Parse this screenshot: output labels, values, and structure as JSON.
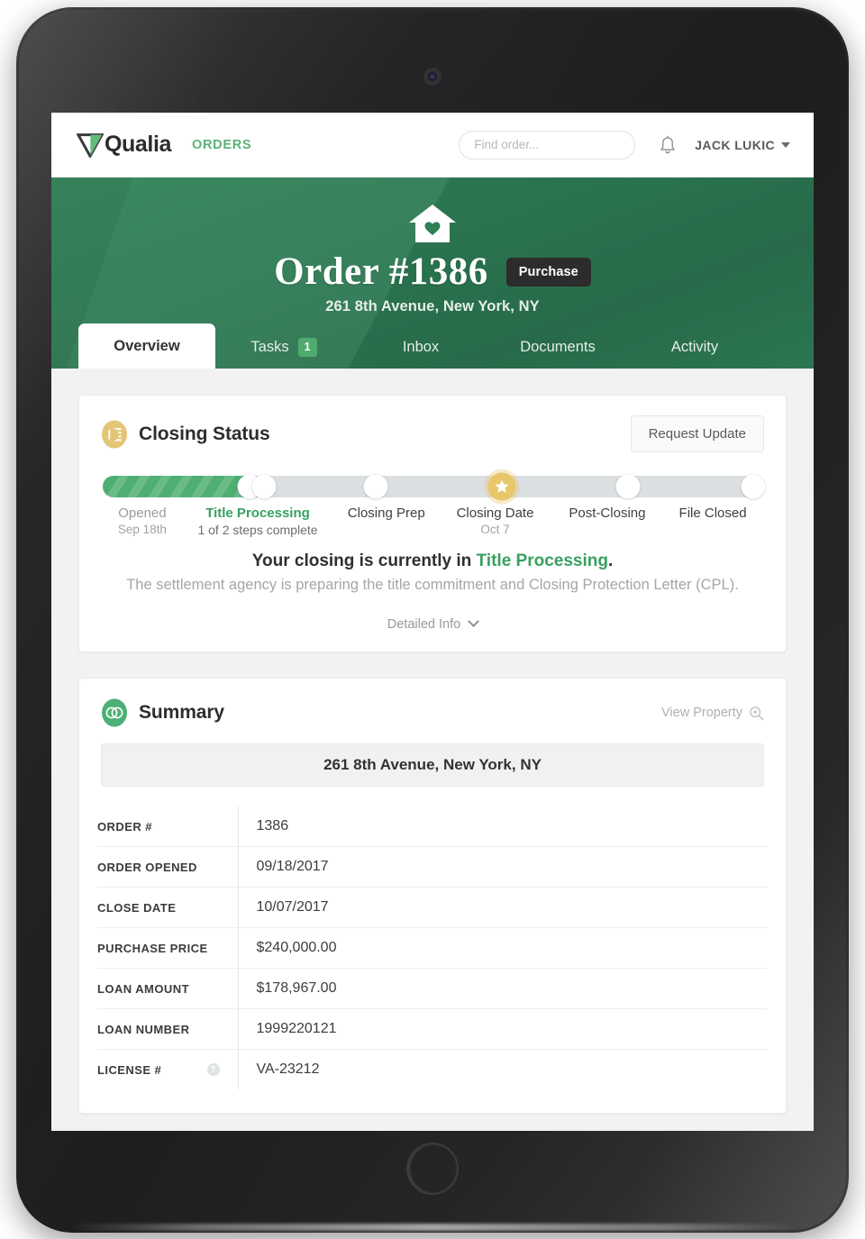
{
  "nav": {
    "logo_text": "Qualia",
    "logo_icon": "qualia-v-logo",
    "orders_link": "ORDERS",
    "search_placeholder": "Find order...",
    "search_value": "",
    "search_icon": "search-icon",
    "bell_icon": "bell-icon",
    "user_name": "JACK LUKIC",
    "caret_icon": "chevron-down-icon"
  },
  "hero": {
    "house_icon": "house-heart-icon",
    "title": "Order #1386",
    "badge": "Purchase",
    "address": "261 8th Avenue, New York, NY"
  },
  "tabs": [
    {
      "label": "Overview",
      "badge": null,
      "active": true
    },
    {
      "label": "Tasks",
      "badge": "1",
      "active": false
    },
    {
      "label": "Inbox",
      "badge": null,
      "active": false
    },
    {
      "label": "Documents",
      "badge": null,
      "active": false
    },
    {
      "label": "Activity",
      "badge": null,
      "active": false
    }
  ],
  "closing_status": {
    "icon": "document-lines-icon",
    "title": "Closing Status",
    "request_update_label": "Request Update",
    "progress_percent": 24.5,
    "steps": [
      {
        "name": "Opened",
        "sub": "Sep 18th",
        "state": "done",
        "node": "plain"
      },
      {
        "name": "Title Processing",
        "sub": "1 of 2 steps complete",
        "state": "current",
        "node": "plain"
      },
      {
        "name": "Closing Prep",
        "sub": "",
        "state": "pending",
        "node": "plain"
      },
      {
        "name": "Closing Date",
        "sub": "Oct 7",
        "state": "pending",
        "node": "star"
      },
      {
        "name": "Post-Closing",
        "sub": "",
        "state": "pending",
        "node": "plain"
      },
      {
        "name": "File Closed",
        "sub": "",
        "state": "pending",
        "node": "plain"
      }
    ],
    "status_prefix": "Your closing is currently in ",
    "status_highlight": "Title Processing",
    "status_suffix": ".",
    "status_description": "The settlement agency is preparing the title commitment and Closing Protection Letter (CPL).",
    "detailed_info_label": "Detailed Info",
    "detailed_info_icon": "chevron-down-icon"
  },
  "summary": {
    "icon": "venn-circles-icon",
    "title": "Summary",
    "view_property_label": "View Property",
    "view_property_icon": "magnify-plus-icon",
    "address_bar": "261 8th Avenue, New York, NY",
    "rows": [
      {
        "label": "ORDER #",
        "value": "1386",
        "help": false
      },
      {
        "label": "ORDER OPENED",
        "value": "09/18/2017",
        "help": false
      },
      {
        "label": "CLOSE DATE",
        "value": "10/07/2017",
        "help": false
      },
      {
        "label": "PURCHASE PRICE",
        "value": "$240,000.00",
        "help": false
      },
      {
        "label": "LOAN AMOUNT",
        "value": "$178,967.00",
        "help": false
      },
      {
        "label": "LOAN NUMBER",
        "value": "1999220121",
        "help": false
      },
      {
        "label": "LICENSE #",
        "value": "VA-23212",
        "help": true
      }
    ]
  },
  "colors": {
    "brand_green": "#2c7a53",
    "accent_green": "#38a05f",
    "progress_green": "#4fae72",
    "gold": "#e8c66a",
    "badge_dark": "#2c2c2c"
  }
}
